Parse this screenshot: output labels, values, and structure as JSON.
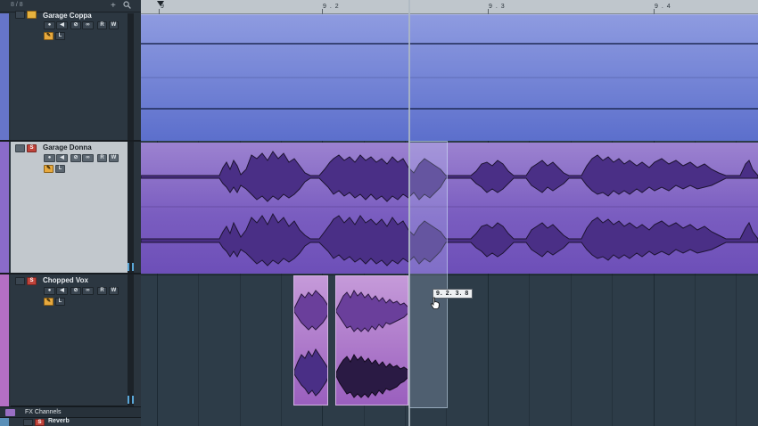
{
  "header": {
    "track_count": "8 / 8",
    "add_icon": "plus-icon",
    "search_icon": "search-icon"
  },
  "ruler": {
    "bars": [
      {
        "label": "9"
      },
      {
        "label": "9 . 2"
      },
      {
        "label": "9 . 3"
      },
      {
        "label": "9 . 4"
      }
    ]
  },
  "tracks": [
    {
      "name": "Garage Coppa",
      "color": "#6675c9",
      "buttons": {
        "mute": "",
        "solo": "",
        "rec": "●",
        "monitor": "◀",
        "read": "R",
        "write": "W",
        "edit": "✎",
        "lanes": "L"
      }
    },
    {
      "name": "Garage Donna",
      "color": "#8a6bc9",
      "buttons": {
        "mute": "",
        "solo": "S",
        "rec": "●",
        "monitor": "◀",
        "read": "R",
        "write": "W",
        "edit": "✎",
        "lanes": "L"
      }
    },
    {
      "name": "Chopped Vox",
      "color": "#b46fc4",
      "buttons": {
        "mute": "",
        "solo": "S",
        "rec": "●",
        "monitor": "◀",
        "read": "R",
        "write": "W",
        "edit": "✎",
        "lanes": "L"
      }
    }
  ],
  "fx_folder": {
    "name": "FX Channels"
  },
  "reverb": {
    "name": "Reverb",
    "solo": "S"
  },
  "position_tooltip": "9. 2. 3. 8",
  "colors": {
    "coppa_event": "#6f80d6",
    "donna_event": "#7f62c2",
    "chopped_event": "#b07ccd",
    "solo": "#c0443b",
    "edit": "#e7a93e"
  },
  "icons": {
    "solo": "solo-icon",
    "mute": "mute-icon",
    "monitor": "speaker-icon",
    "edit": "pencil-icon",
    "mouse": "hand-pointer-icon",
    "folder": "folder-icon"
  }
}
